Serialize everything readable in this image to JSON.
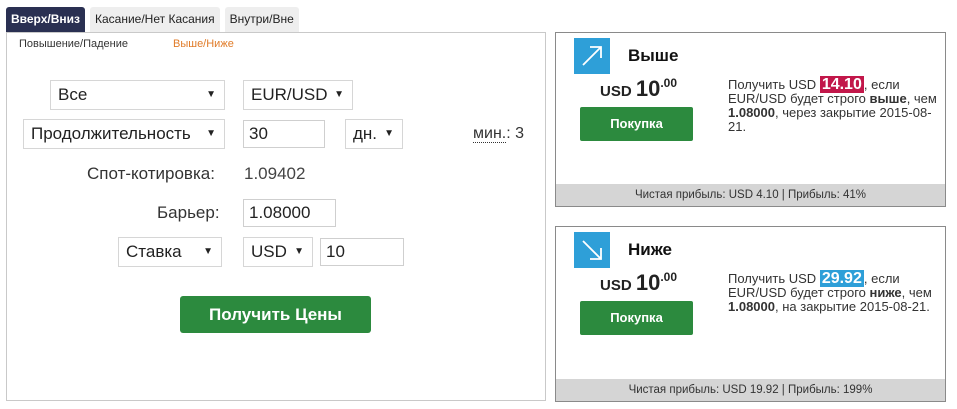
{
  "tabs": [
    "Вверх/Вниз",
    "Касание/Нет Касания",
    "Внутри/Вне"
  ],
  "subtabs": [
    "Повышение/Падение",
    "Выше/Ниже"
  ],
  "form": {
    "market_select": "Все",
    "symbol_select": "EUR/USD",
    "duration_select": "Продолжительность",
    "duration_value": "30",
    "duration_unit": "дн.",
    "min_label": "мин.",
    "min_value": ": 3",
    "spot_label": "Спот-котировка:",
    "spot_value": "1.09402",
    "barrier_label": "Барьер:",
    "barrier_value": "1.08000",
    "stake_select": "Ставка",
    "currency_select": "USD",
    "stake_value": "10",
    "get_prices_label": "Получить Цены"
  },
  "cards": [
    {
      "title": "Выше",
      "icon": "arrow-up-right-icon",
      "currency": "USD",
      "price_int": "10",
      "price_dec": ".00",
      "buy_label": "Покупка",
      "desc_pre": "Получить USD ",
      "payout": "14.10",
      "desc_mid1": ", если EUR/USD будет строго ",
      "direction": "выше",
      "desc_mid2": ", чем ",
      "barrier": "1.08000",
      "desc_post": ", через закрытие 2015-08-21.",
      "footer": "Чистая прибыль: USD 4.10 | Прибыль: 41%",
      "highlight_color": "#c2174a"
    },
    {
      "title": "Ниже",
      "icon": "arrow-down-right-icon",
      "currency": "USD",
      "price_int": "10",
      "price_dec": ".00",
      "buy_label": "Покупка",
      "desc_pre": "Получить USD ",
      "payout": "29.92",
      "desc_mid1": ", если EUR/USD будет строго ",
      "direction": "ниже",
      "desc_mid2": ", чем ",
      "barrier": "1.08000",
      "desc_post": ", на закрытие 2015-08-21.",
      "footer": "Чистая прибыль: USD 19.92 | Прибыль: 199%",
      "highlight_color": "#2e9fd8"
    }
  ],
  "colors": {
    "active_tab": "#2a3052",
    "buy_green": "#2c8a3e",
    "accent_orange": "#e07b28"
  }
}
